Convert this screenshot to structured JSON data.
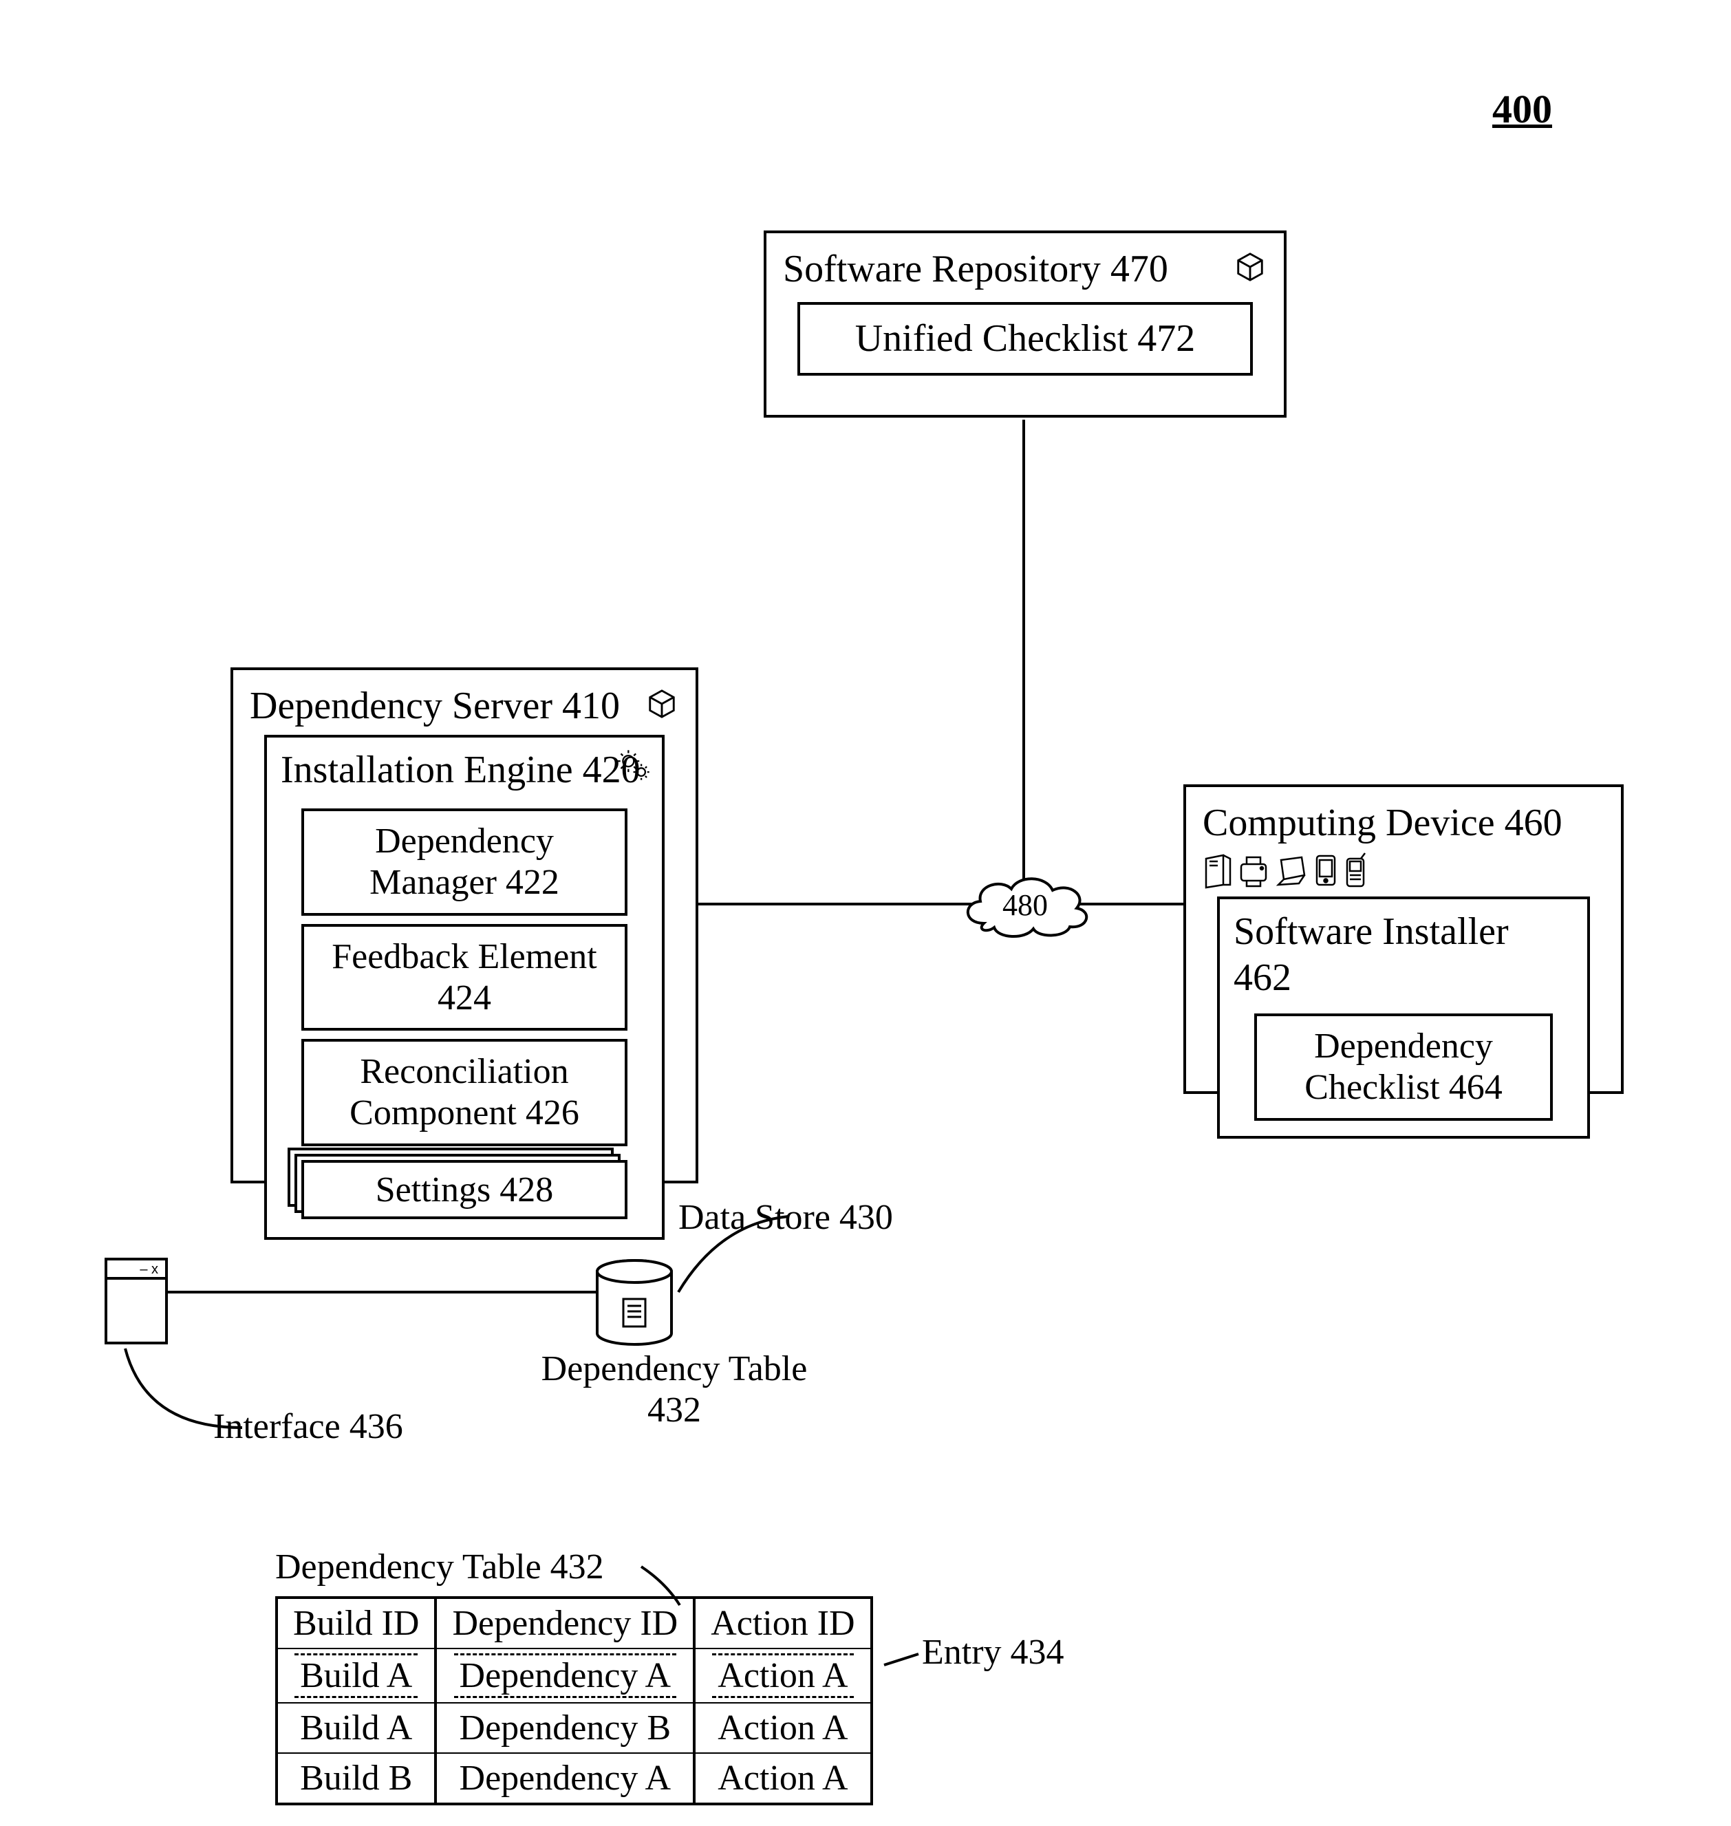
{
  "figure_number": "400",
  "repo": {
    "title": "Software Repository 470",
    "unified_checklist": "Unified Checklist 472"
  },
  "dep_server": {
    "title": "Dependency Server 410",
    "engine_title": "Installation Engine 420",
    "dep_manager": "Dependency Manager 422",
    "feedback": "Feedback Element 424",
    "reconciliation": "Reconciliation Component 426",
    "settings": "Settings 428"
  },
  "device": {
    "title": "Computing Device 460",
    "installer_title": "Software Installer 462",
    "checklist": "Dependency Checklist 464"
  },
  "network_label": "480",
  "datastore_label": "Data Store 430",
  "dep_table_label": "Dependency Table 432",
  "interface_label": "Interface 436",
  "table_caption": "Dependency Table 432",
  "entry_label": "Entry 434",
  "table": {
    "headers": [
      "Build ID",
      "Dependency ID",
      "Action ID"
    ],
    "rows": [
      [
        "Build A",
        "Dependency A",
        "Action A"
      ],
      [
        "Build A",
        "Dependency B",
        "Action A"
      ],
      [
        "Build B",
        "Dependency A",
        "Action A"
      ]
    ]
  }
}
